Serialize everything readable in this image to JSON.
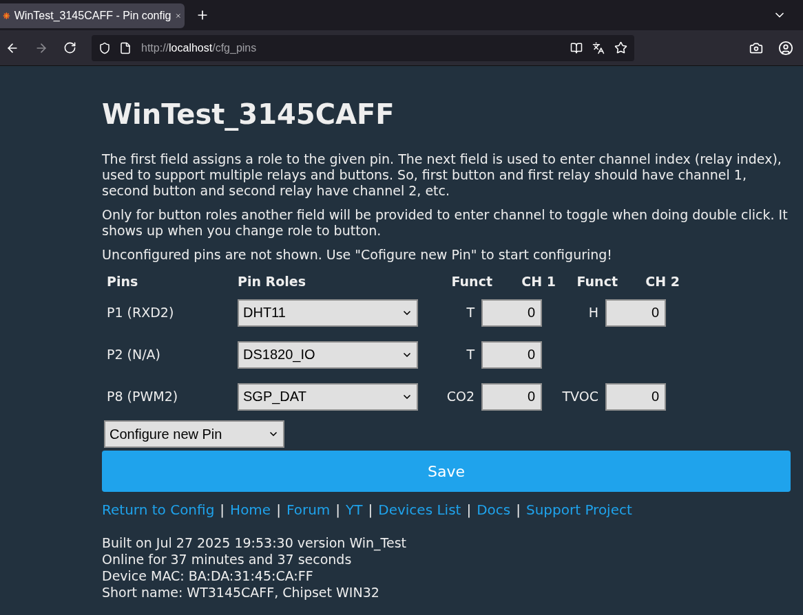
{
  "browser": {
    "tab": {
      "title": "WinTest_3145CAFF - Pin config",
      "selected": true
    },
    "url": {
      "scheme": "http://",
      "host": "localhost",
      "path": "/cfg_pins"
    }
  },
  "page": {
    "title": "WinTest_3145CAFF",
    "paragraphs": [
      "The first field assigns a role to the given pin. The next field is used to enter channel index (relay index), used to support multiple relays and buttons. So, first button and first relay should have channel 1, second button and second relay have channel 2, etc.",
      "Only for button roles another field will be provided to enter channel to toggle when doing double click. It shows up when you change role to button.",
      "Unconfigured pins are not shown. Use \"Cofigure new Pin\" to start configuring!"
    ],
    "table": {
      "columns": [
        "Pins",
        "Pin Roles",
        "Funct",
        "CH 1",
        "Funct",
        "CH 2"
      ],
      "rows": [
        {
          "pin": "P1 (RXD2)",
          "role": "DHT11",
          "channels": [
            {
              "funct": "T",
              "value": "0"
            },
            {
              "funct": "H",
              "value": "0"
            }
          ]
        },
        {
          "pin": "P2 (N/A)",
          "role": "DS1820_IO",
          "channels": [
            {
              "funct": "T",
              "value": "0"
            }
          ]
        },
        {
          "pin": "P8 (PWM2)",
          "role": "SGP_DAT",
          "channels": [
            {
              "funct": "CO2",
              "value": "0"
            },
            {
              "funct": "TVOC",
              "value": "0"
            }
          ]
        }
      ]
    },
    "new_pin_select": "Configure new Pin",
    "save_button": "Save",
    "links": [
      "Return to Config",
      "Home",
      "Forum",
      "YT",
      "Devices List",
      "Docs",
      "Support Project"
    ],
    "separator": "|",
    "info_lines": [
      "Built on Jul 27 2025 19:53:30 version Win_Test",
      "Online for 37 minutes and 37 seconds",
      "Device MAC: BA:DA:31:45:CA:FF",
      "Short name: WT3145CAFF, Chipset WIN32"
    ]
  }
}
